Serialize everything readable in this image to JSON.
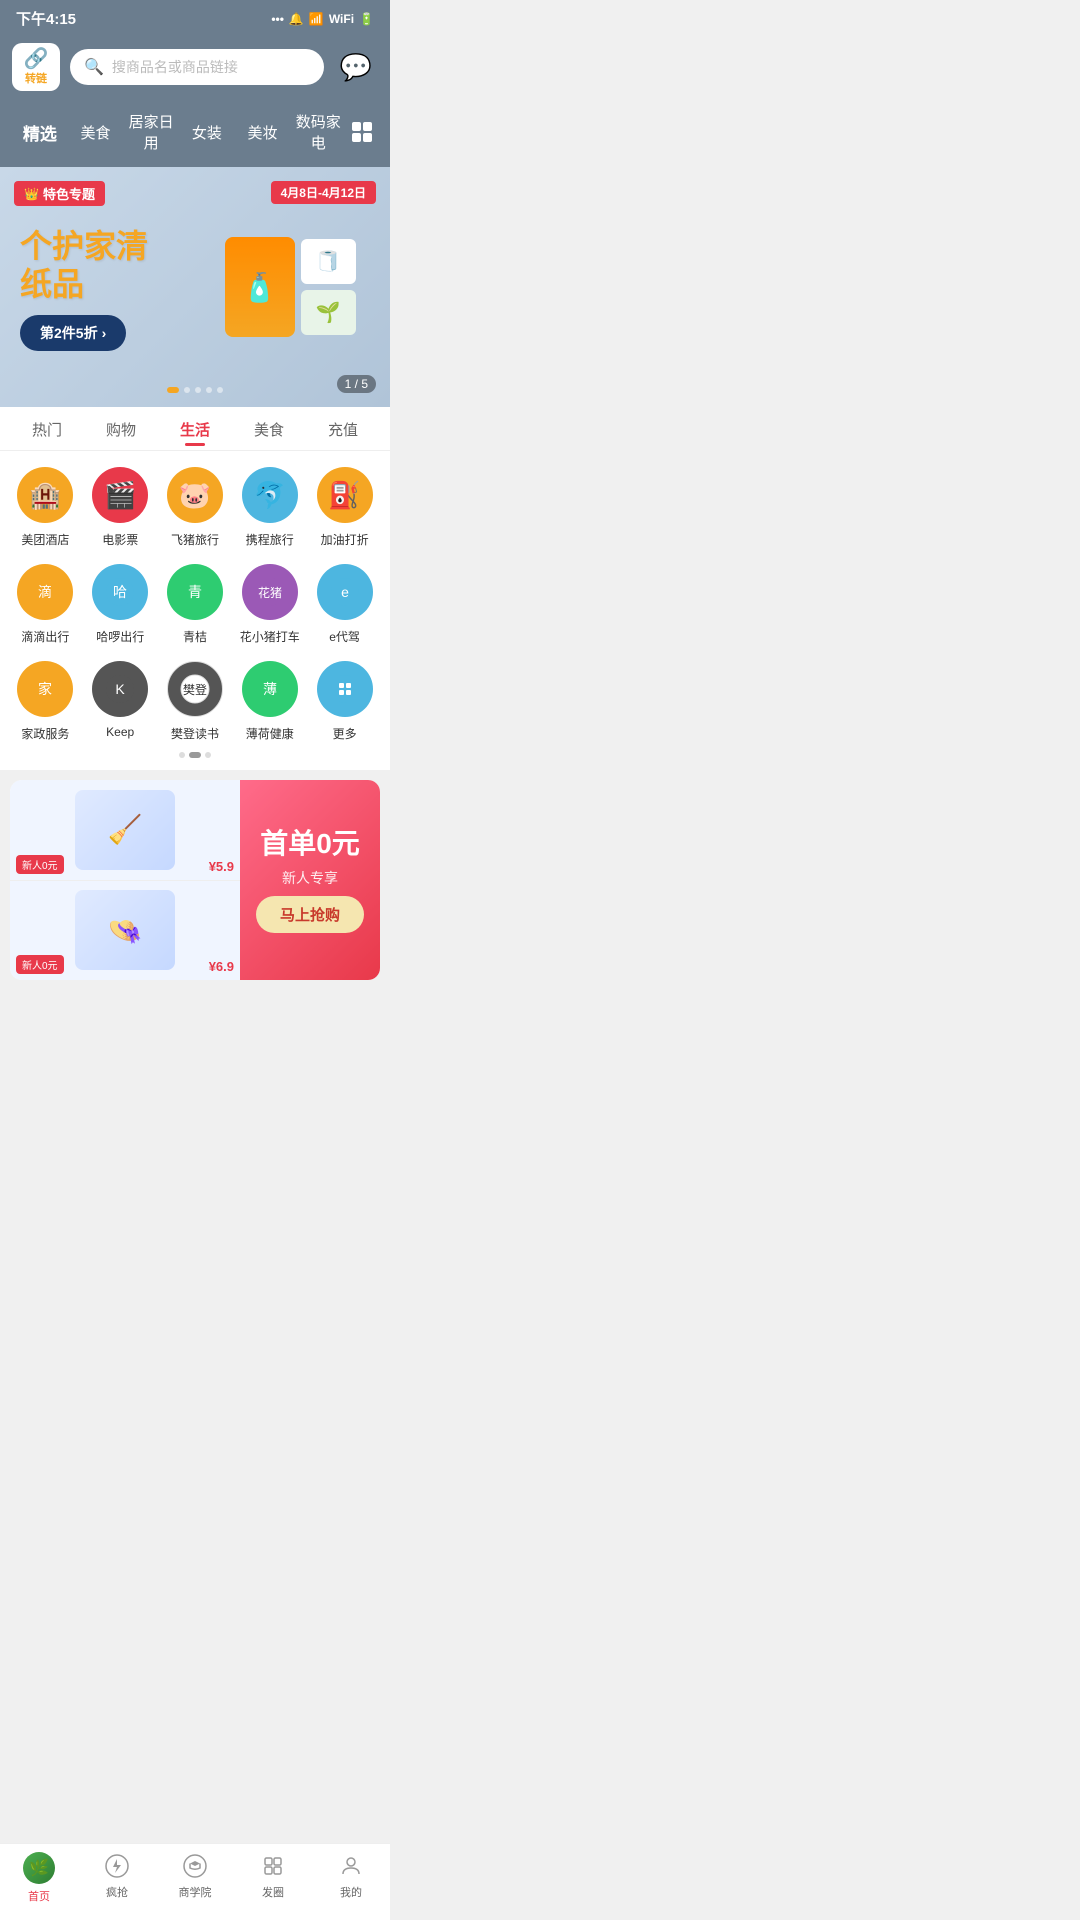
{
  "statusBar": {
    "time": "下午4:15",
    "icons": "... 🔔 📶 🔋"
  },
  "header": {
    "logoLabel": "转链",
    "searchPlaceholder": "搜商品名或商品链接"
  },
  "categoryNav": {
    "items": [
      "精选",
      "美食",
      "居家日用",
      "女装",
      "美妆",
      "数码家电"
    ],
    "activeIndex": 0
  },
  "banner": {
    "tag": "特色专题",
    "date": "4月8日-4月12日",
    "title": "个护家清纸品",
    "ctaLabel": "第2件5折",
    "indicator": "1 / 5"
  },
  "tabs": {
    "items": [
      "热门",
      "购物",
      "生活",
      "美食",
      "充值"
    ],
    "activeIndex": 2
  },
  "services": {
    "items": [
      {
        "label": "美团酒店",
        "color": "#f5a623",
        "icon": "🏨"
      },
      {
        "label": "电影票",
        "color": "#e8394a",
        "icon": "🎬"
      },
      {
        "label": "飞猪旅行",
        "color": "#f5a623",
        "icon": "🐷"
      },
      {
        "label": "携程旅行",
        "color": "#4db6e0",
        "icon": "🐬"
      },
      {
        "label": "加油打折",
        "color": "#f5a623",
        "icon": "⛽"
      },
      {
        "label": "滴滴出行",
        "color": "#f5a623",
        "icon": "🚗"
      },
      {
        "label": "哈啰出行",
        "color": "#4db6e0",
        "icon": "🚲"
      },
      {
        "label": "青桔",
        "color": "#2ecc71",
        "icon": "🟢"
      },
      {
        "label": "花小猪打车",
        "color": "#9b59b6",
        "icon": "🐷"
      },
      {
        "label": "e代驾",
        "color": "#4db6e0",
        "icon": "🚗"
      },
      {
        "label": "家政服务",
        "color": "#f5a623",
        "icon": "🧹"
      },
      {
        "label": "Keep",
        "color": "#555",
        "icon": "K"
      },
      {
        "label": "樊登读书",
        "color": "#555",
        "icon": "📚"
      },
      {
        "label": "薄荷健康",
        "color": "#2ecc71",
        "icon": "🌿"
      },
      {
        "label": "更多",
        "color": "#4db6e0",
        "icon": "⊞"
      }
    ]
  },
  "promo": {
    "badge1": "新人0元",
    "price1": "¥5.9",
    "badge2": "新人0元",
    "price2": "¥6.9",
    "rightTitle": "首单0元",
    "rightSub": "新人专享",
    "ctaLabel": "马上抢购"
  },
  "bottomBar": {
    "items": [
      {
        "label": "首页",
        "icon": "🏠",
        "active": true
      },
      {
        "label": "疯抢",
        "icon": "🔥",
        "active": false
      },
      {
        "label": "商学院",
        "icon": "👑",
        "active": false
      },
      {
        "label": "发圈",
        "icon": "⊞",
        "active": false
      },
      {
        "label": "我的",
        "icon": "👤",
        "active": false
      }
    ]
  }
}
